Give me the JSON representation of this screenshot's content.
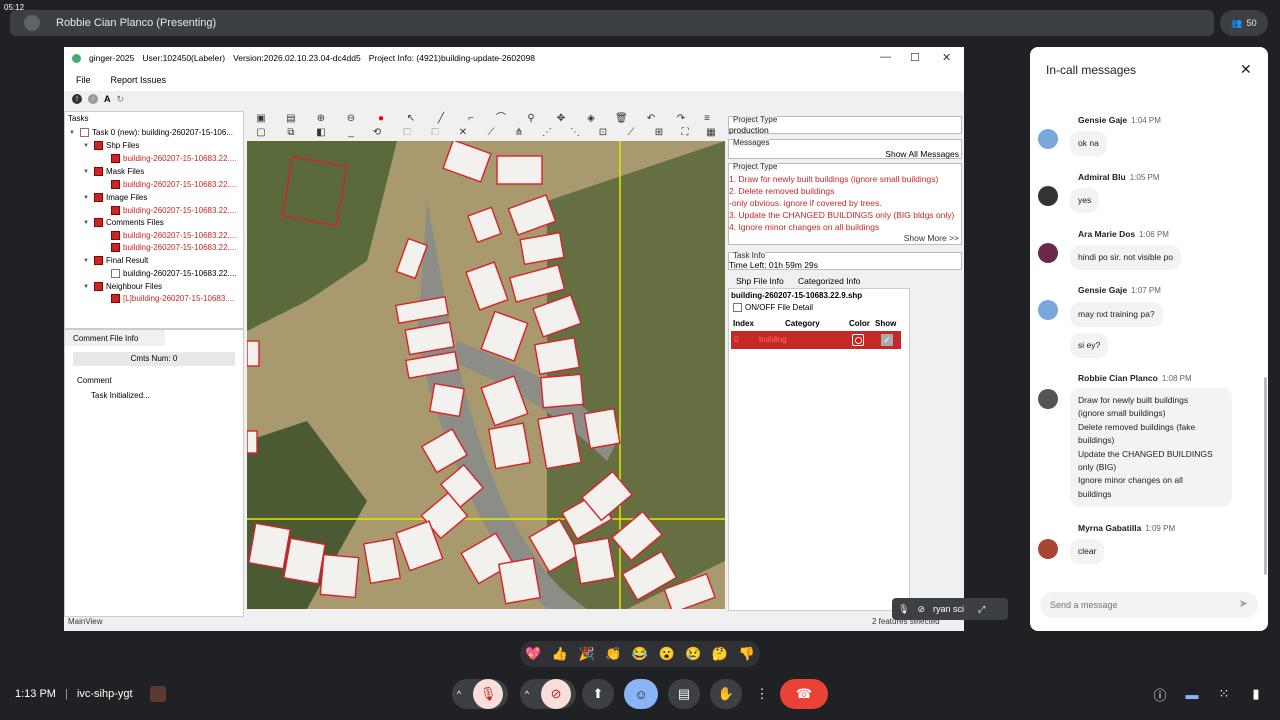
{
  "clock_top": "05:12",
  "presenter": "Robbie Cian Planco (Presenting)",
  "participant_count": "50",
  "window": {
    "app_name": "ginger-2025",
    "user": "User:102450(Labeler)",
    "version": "Version:2026.02.10.23.04-dc4dd5",
    "project_info": "Project Info: (4921)building-update-2602098"
  },
  "menu": {
    "file": "File",
    "report": "Report Issues"
  },
  "tasks": {
    "header": "Tasks",
    "root": "Task 0 (new): building-260207-15-106...",
    "groups": [
      {
        "label": "Shp Files",
        "files": [
          "building-260207-15-10683.22...."
        ]
      },
      {
        "label": "Mask Files",
        "files": [
          "building-260207-15-10683.22...."
        ]
      },
      {
        "label": "Image Files",
        "files": [
          "building-260207-15-10683.22...."
        ]
      },
      {
        "label": "Comments Files",
        "files": [
          "building-260207-15-10683.22....",
          "building-260207-15-10683.22...."
        ]
      },
      {
        "label": "Final Result",
        "files": [
          "building-260207-15-10683.22...."
        ]
      },
      {
        "label": "Neighbour Files",
        "files": [
          "[L]building-260207-15-10683...."
        ]
      }
    ]
  },
  "comment": {
    "tab": "Comment File Info",
    "num": "Cmts Num:  0",
    "label": "Comment",
    "entry": "Task Initialized..."
  },
  "right": {
    "project_type_title": "Project Type",
    "project_type_value": "production",
    "messages_title": "Messages",
    "show_all": "Show All Messages",
    "project_type2_title": "Project Type",
    "instructions": [
      "1. Draw for newly built buildings (ignore small buildings)",
      "2. Delete removed buildings",
      "-only obvious. ignore if covered by trees.",
      "3. Update the CHANGED BUILDINGS only (BIG bldgs only)",
      "4. Ignore minor changes on all buildings"
    ],
    "show_more": "Show More >>",
    "task_info_title": "Task Info",
    "time_left": "Time Left: 01h 59m 29s",
    "tabs": [
      "Shp File Info",
      "Categorized Info"
    ],
    "shp_file": "building-260207-15-10683.22.9.shp",
    "onoff": "ON/OFF File Detail",
    "columns": [
      "Index",
      "Category",
      "Color",
      "Show"
    ],
    "row": {
      "index": "0",
      "category": "building"
    }
  },
  "status": {
    "left": "MainView",
    "right": "2 features selected"
  },
  "chat": {
    "title": "In-call messages",
    "messages": [
      {
        "name": "Gensie Gaje",
        "time": "1:04 PM",
        "text": "ok na"
      },
      {
        "name": "Admiral Blu",
        "time": "1:05 PM",
        "text": "yes"
      },
      {
        "name": "Ara Marie Dos",
        "time": "1:06 PM",
        "text": "hindi po sir. not visible po"
      },
      {
        "name": "Gensie Gaje",
        "time": "1:07 PM",
        "text": "may nxt training pa?",
        "text2": "si ey?"
      },
      {
        "name": "Robbie Cian Planco",
        "time": "1:08 PM",
        "lines": [
          "Draw for newly built buildings",
          "(ignore small buildings)",
          "Delete removed buildings (fake",
          "buildings)",
          "Update the CHANGED BUILDINGS",
          "only (BIG)",
          "Ignore minor changes on all",
          "buildings"
        ]
      },
      {
        "name": "Myrna Gabatilla",
        "time": "1:09 PM",
        "text": "clear"
      }
    ],
    "placeholder": "Send a message"
  },
  "self_view": "ryan sci",
  "bottom": {
    "time": "1:13 PM",
    "meeting": "ivc-sihp-ygt"
  },
  "reactions": [
    "💖",
    "👍",
    "🎉",
    "👏",
    "😂",
    "😮",
    "😢",
    "🤔",
    "👎"
  ]
}
